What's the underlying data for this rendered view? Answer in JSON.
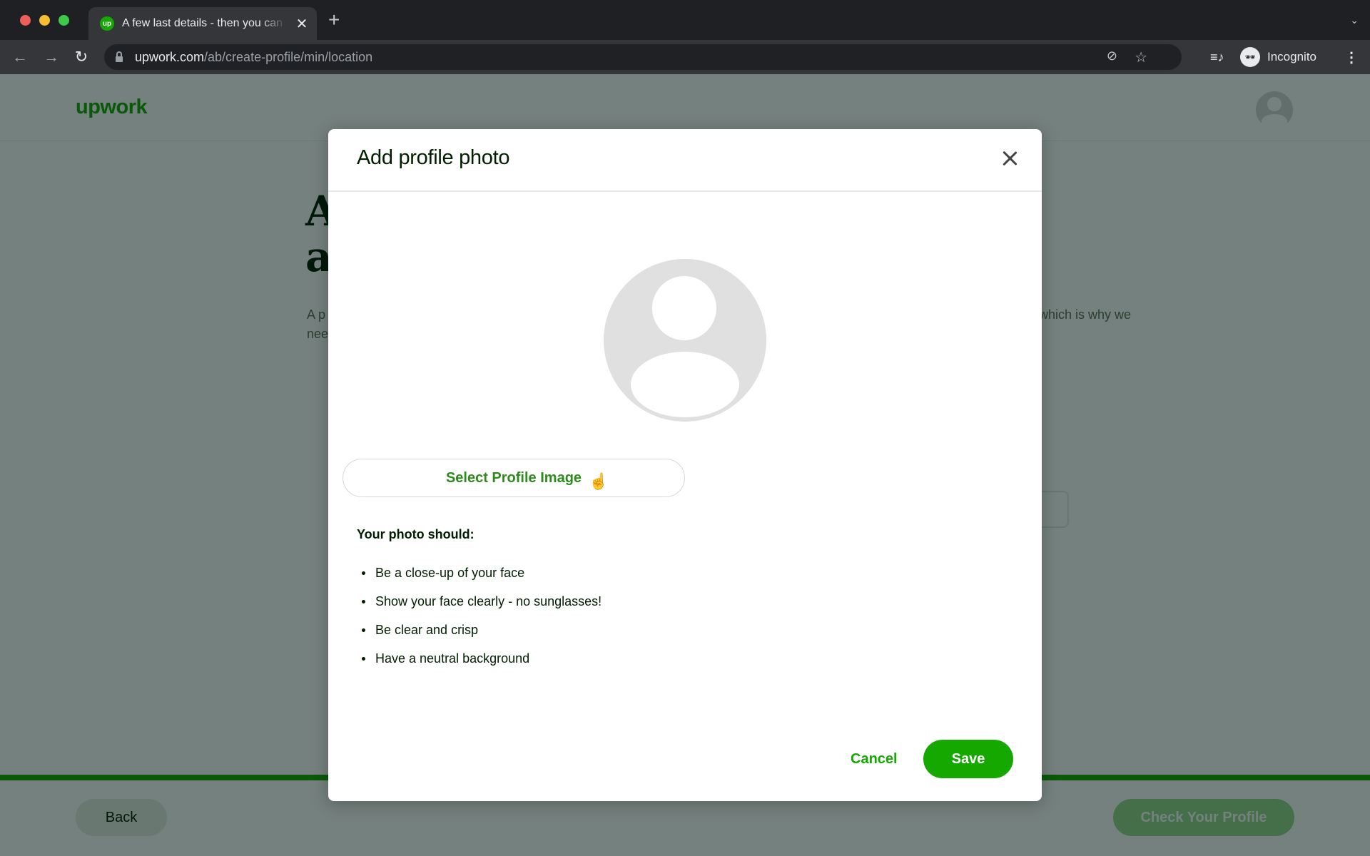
{
  "browser": {
    "tab_title": "A few last details - then you can check and publish your profile.",
    "tab_favicon_text": "up",
    "url_host": "upwork.com",
    "url_path": "/ab/create-profile/min/location",
    "profile_label": "Incognito",
    "icons": {
      "back": "←",
      "forward": "→",
      "reload": "↻",
      "new_tab": "+",
      "tab_close": "✕",
      "tab_search": "⌄",
      "eye_off": "⊘",
      "star": "☆",
      "media": "≡♪",
      "incognito": "🕶",
      "menu": "⋮"
    }
  },
  "page": {
    "logo": "upwork",
    "heading_line1": "A",
    "heading_line2": "a",
    "body_left": "A p\nnee",
    "body_right": "which is why we",
    "back_label": "Back",
    "check_profile_label": "Check Your Profile",
    "accent_color": "#14a800"
  },
  "modal": {
    "title": "Add profile photo",
    "select_image_label": "Select Profile Image",
    "requirements_heading": "Your photo should:",
    "requirements": [
      "Be a close-up of your face",
      "Show your face clearly - no sunglasses!",
      "Be clear and crisp",
      "Have a neutral background"
    ],
    "cancel_label": "Cancel",
    "save_label": "Save",
    "cursor_icon": "☝"
  }
}
